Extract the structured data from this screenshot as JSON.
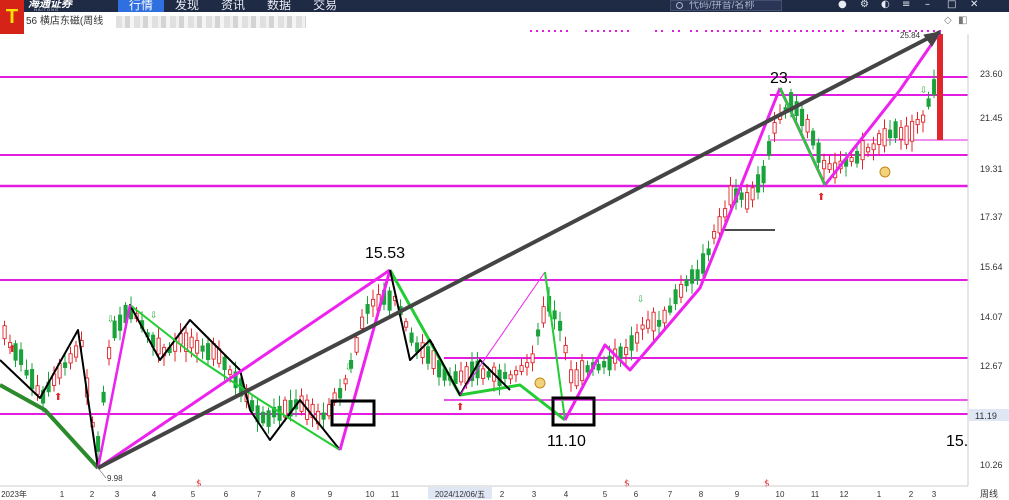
{
  "app": {
    "logo_letter": "T",
    "brand_name": "海通证券",
    "brand_sub": "HAITONG"
  },
  "nav": {
    "items": [
      {
        "label": "行情",
        "active": true
      },
      {
        "label": "发现",
        "active": false
      },
      {
        "label": "资讯",
        "active": false
      },
      {
        "label": "数据",
        "active": false
      },
      {
        "label": "交易",
        "active": false
      }
    ]
  },
  "search": {
    "placeholder": "代码/拼音/名称"
  },
  "toolbar_icons": [
    "bell-icon",
    "gear-icon",
    "theme-icon",
    "menu-icon",
    "minimize-icon",
    "maximize-icon",
    "close-icon"
  ],
  "stock": {
    "title": "56 横店东磁(周线"
  },
  "price_axis": {
    "labels": [
      "23.60",
      "21.45",
      "19.31",
      "17.37",
      "15.64",
      "14.07",
      "12.67",
      "10.26"
    ],
    "current_price": "11.19",
    "period_label": "周线"
  },
  "date_axis": {
    "labels": [
      "2023年",
      "1",
      "2",
      "3",
      "4",
      "5",
      "6",
      "7",
      "8",
      "9",
      "10",
      "11",
      "2024/12/06/五",
      "2",
      "3",
      "4",
      "5",
      "6",
      "7",
      "8",
      "9",
      "10",
      "11",
      "12",
      "1",
      "2",
      "3"
    ]
  },
  "annotations": {
    "high_1": "15.53",
    "low_1": "11.10",
    "high_2": "23.",
    "low_left": "9.98",
    "top_right": "25.84",
    "right_partial": "15."
  },
  "colors": {
    "up": "#e0262a",
    "down": "#1aa33b",
    "level_line": "#e21ce0",
    "trend_magenta": "#ee22ee",
    "trend_green": "#22cc33",
    "trend_dark_green": "#2b8a2b",
    "trend_black": "#000000",
    "trend_gray": "#444444",
    "current_price_bg": "#dfe7f5"
  }
}
